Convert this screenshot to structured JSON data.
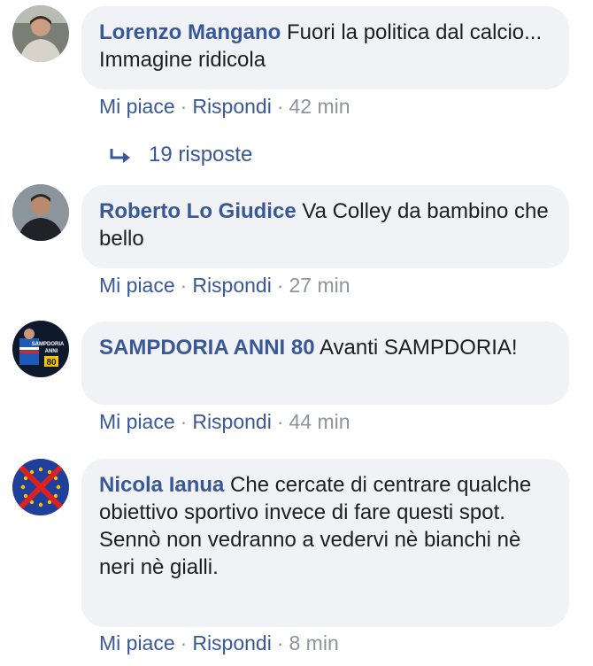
{
  "comments": [
    {
      "author": "Lorenzo Mangano",
      "text": "Fuori la politica dal calcio... Immagine ridicola",
      "like": "Mi piace",
      "reply": "Rispondi",
      "sep": "·",
      "time": "42 min"
    },
    {
      "author": "Roberto Lo Giudice",
      "text": "Va Colley da bambino che bello",
      "like": "Mi piace",
      "reply": "Rispondi",
      "sep": "·",
      "time": "27 min"
    },
    {
      "author": "SAMPDORIA ANNI 80",
      "text": "Avanti SAMPDORIA!",
      "like": "Mi piace",
      "reply": "Rispondi",
      "sep": "·",
      "time": "44 min"
    },
    {
      "author": "Nicola Ianua",
      "text_lines": [
        "Che cercate di centrare qualche obiettivo sportivo invece di fare questi spot.",
        "Sennò non vedranno a vedervi nè bianchi nè neri nè gialli."
      ],
      "like": "Mi piace",
      "reply": "Rispondi",
      "sep": "·",
      "time": "8 min"
    }
  ],
  "replies_link": {
    "label": "19 risposte",
    "icon": "reply-arrow-icon"
  },
  "avatars": {
    "sampdoria_badge_text": [
      "SAMPDORIA",
      "ANNI",
      "80"
    ]
  },
  "colors": {
    "link": "#385898",
    "muted": "#8d949e",
    "bubble": "#f0f2f5",
    "text": "#1c1e21"
  }
}
